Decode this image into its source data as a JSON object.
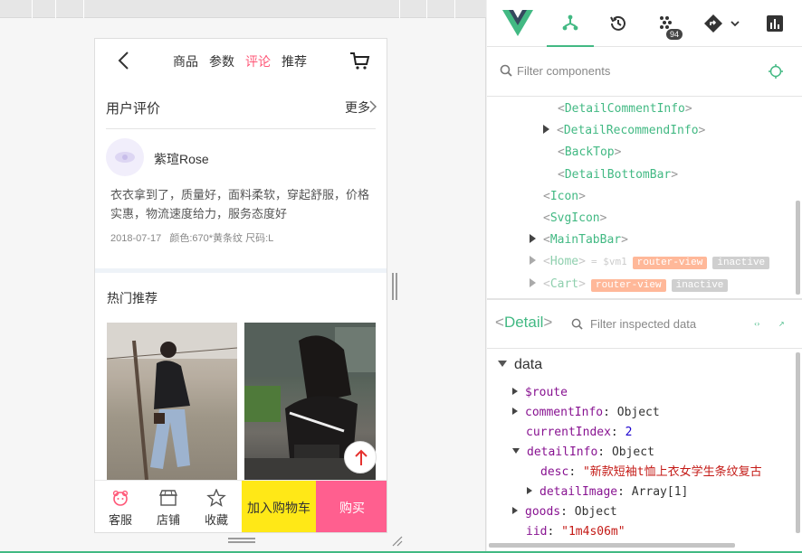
{
  "phone": {
    "tabs": [
      "商品",
      "参数",
      "评论",
      "推荐"
    ],
    "comment_header": "用户评价",
    "more_label": "更多",
    "user_name": "紫瑄Rose",
    "comment_text": "衣衣拿到了，质量好，面料柔软，穿起舒服，价格实惠，物流速度给力，服务态度好",
    "comment_date": "2018-07-17",
    "comment_style": "颜色:670*黄条纹 尺码:L",
    "recommend_title": "热门推荐",
    "bottom": {
      "service": "客服",
      "shop": "店铺",
      "favorite": "收藏",
      "add_cart": "加入购物车",
      "buy": "购买"
    }
  },
  "devtools": {
    "badge_count": "94",
    "filter_components_placeholder": "Filter components",
    "tree": [
      {
        "name": "DetailCommentInfo",
        "expandable": false
      },
      {
        "name": "DetailRecommendInfo",
        "expandable": true
      },
      {
        "name": "BackTop",
        "expandable": false
      },
      {
        "name": "DetailBottomBar",
        "expandable": false
      },
      {
        "name": "Icon",
        "expandable": false
      },
      {
        "name": "SvgIcon",
        "expandable": false
      },
      {
        "name": "MainTabBar",
        "expandable": true
      },
      {
        "name": "Home",
        "vm": "= $vm1",
        "tags": [
          "router-view",
          "inactive"
        ]
      },
      {
        "name": "Cart",
        "tags": [
          "router-view",
          "inactive"
        ]
      }
    ],
    "inspected_component": "Detail",
    "filter_inspected_placeholder": "Filter inspected data",
    "data_section": "data",
    "data_rows": [
      {
        "key": "$route",
        "value": ""
      },
      {
        "key": "commentInfo",
        "value": "Object"
      },
      {
        "key": "currentIndex",
        "value": "2"
      },
      {
        "key": "detailInfo",
        "value": "Object"
      },
      {
        "key": "desc",
        "value": "\"新款短袖t恤上衣女学生条纹复古"
      },
      {
        "key": "detailImage",
        "value": "Array[1]"
      },
      {
        "key": "goods",
        "value": "Object"
      },
      {
        "key": "iid",
        "value": "\"1m4s06m\""
      }
    ]
  },
  "colors": {
    "vue_green": "#42b983",
    "pink": "#ff5777",
    "yellow": "#ffe817",
    "buy_pink": "#ff5f8f"
  }
}
